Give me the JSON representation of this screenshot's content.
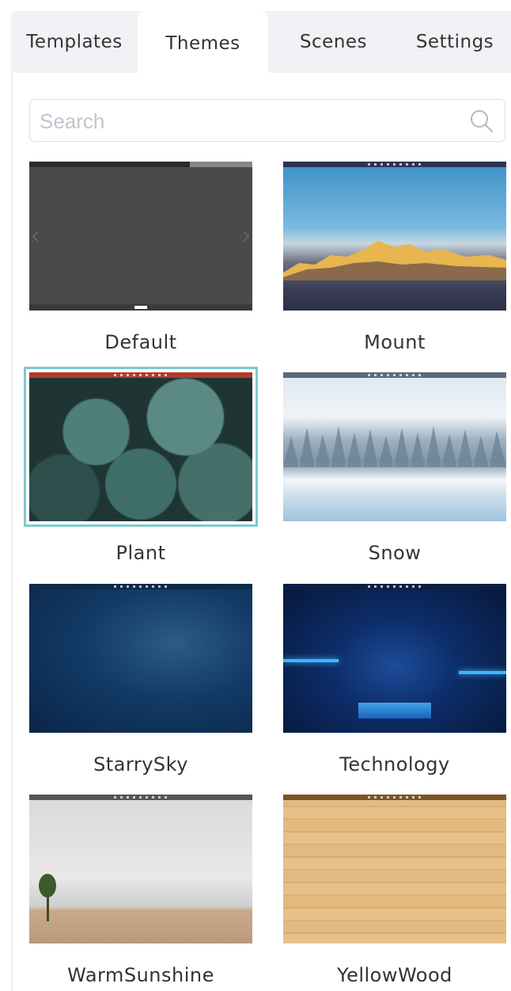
{
  "tabs": [
    {
      "label": "Templates"
    },
    {
      "label": "Themes",
      "active": true
    },
    {
      "label": "Scenes"
    },
    {
      "label": "Settings"
    }
  ],
  "search": {
    "placeholder": "Search",
    "value": "",
    "icon": "search-icon"
  },
  "themes": [
    {
      "name": "Default"
    },
    {
      "name": "Mount"
    },
    {
      "name": "Plant",
      "selected": true
    },
    {
      "name": "Snow"
    },
    {
      "name": "StarrySky"
    },
    {
      "name": "Technology"
    },
    {
      "name": "WarmSunshine"
    },
    {
      "name": "YellowWood"
    }
  ],
  "colors": {
    "selected_outline": "#7ec9cc",
    "tab_bar_bg": "#f1f2f5"
  }
}
